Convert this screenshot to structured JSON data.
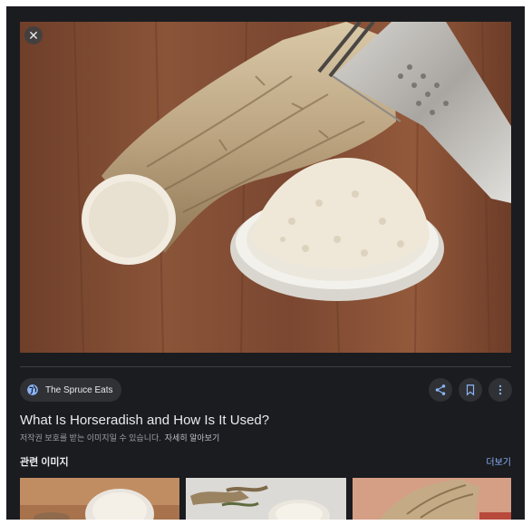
{
  "image": {
    "close_icon": "close-icon"
  },
  "source": {
    "name": "The Spruce Eats",
    "icon": "globe-icon"
  },
  "actions": {
    "share_icon": "share-icon",
    "save_icon": "bookmark-icon",
    "more_icon": "more-vert-icon"
  },
  "title": "What Is Horseradish and How Is It Used?",
  "copyright": {
    "notice": "저작권 보호를 받는 이미지일 수 있습니다.",
    "learn_more": "자세히 알아보기"
  },
  "related": {
    "heading": "관련 이미지",
    "more_label": "더보기"
  },
  "colors": {
    "panel_bg": "#1b1c20",
    "chip_bg": "#303134",
    "text_primary": "#e8eaed",
    "text_secondary": "#9aa0a6",
    "link_blue": "#8ab4f8"
  }
}
